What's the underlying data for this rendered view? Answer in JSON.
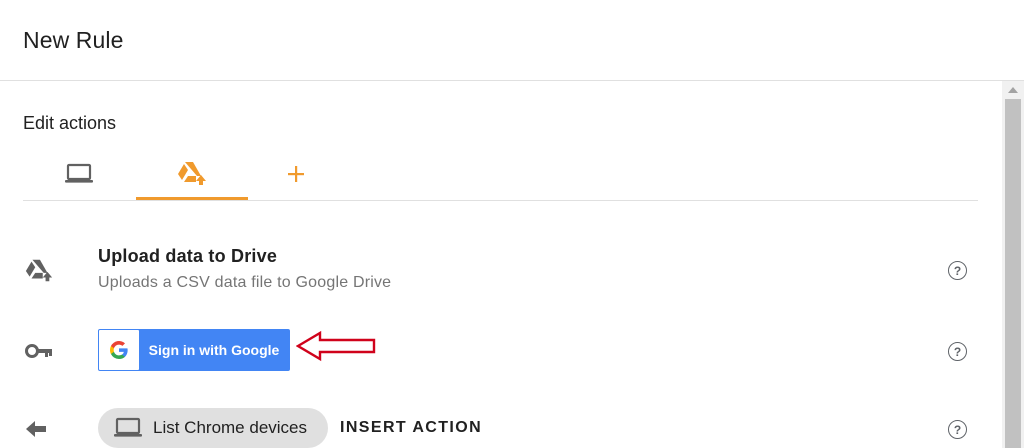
{
  "header": {
    "title": "New Rule"
  },
  "section": {
    "title": "Edit actions"
  },
  "tabs": [
    {
      "icon": "laptop-icon",
      "active": false
    },
    {
      "icon": "drive-upload-icon",
      "active": true
    },
    {
      "icon": "plus-icon",
      "active": false
    }
  ],
  "action": {
    "icon": "drive-upload-icon",
    "title": "Upload data to Drive",
    "description": "Uploads a CSV data file to Google Drive"
  },
  "auth": {
    "icon": "key-icon",
    "button_label": "Sign in with Google"
  },
  "insert": {
    "icon": "arrow-left-icon",
    "chip_label": "List Chrome devices",
    "chip_icon": "laptop-icon",
    "insert_label": "INSERT ACTION"
  },
  "colors": {
    "accent": "#f09a2d",
    "google_blue": "#4285f4",
    "annotation_red": "#d0021b",
    "muted_text": "#757575"
  }
}
